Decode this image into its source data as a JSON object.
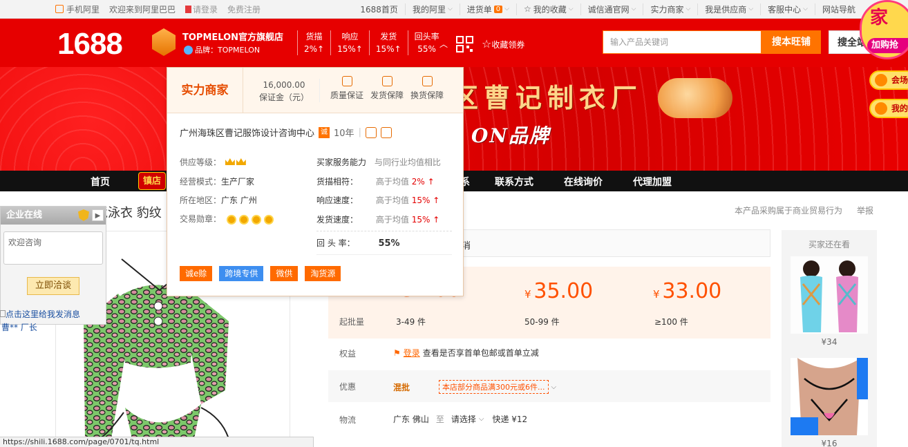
{
  "topnav": {
    "mobile": "手机阿里",
    "welcome": "欢迎来到阿里巴巴",
    "login": "请登录",
    "register": "免费注册",
    "links": [
      {
        "label": "1688首页"
      },
      {
        "label": "我的阿里"
      },
      {
        "label": "进货单",
        "badge": "0"
      },
      {
        "label": "我的收藏"
      },
      {
        "label": "诚信通官网"
      },
      {
        "label": "实力商家"
      },
      {
        "label": "我是供应商"
      },
      {
        "label": "客服中心"
      },
      {
        "label": "网站导航"
      }
    ]
  },
  "header": {
    "logo": "1688",
    "shop_name": "TOPMELON官方旗舰店",
    "brand_label": "品牌：TOPMELON",
    "metrics": [
      {
        "label": "货描",
        "value": "2%↑"
      },
      {
        "label": "响应",
        "value": "15%↑"
      },
      {
        "label": "发货",
        "value": "15%↑"
      },
      {
        "label": "回头率",
        "value": "55%"
      }
    ],
    "fav_coupon": "收藏领券",
    "search_placeholder": "输入产品关键词",
    "search_shop_btn": "搜本旺铺",
    "search_all_btn": "搜全站"
  },
  "promo_side": {
    "big_title": "家",
    "big_button": "加购抢",
    "pill1": "会场",
    "pill2": "我的"
  },
  "banner": {
    "title": "区曹记制衣厂",
    "subtitle": "ON品牌"
  },
  "shopnav": {
    "items": [
      "首页",
      "镇店",
      "联系方式",
      "在线询价",
      "代理加盟"
    ],
    "partial": "系"
  },
  "product": {
    "title": "跨境泳衣 豹纹",
    "report_text": "本产品采购属于商业贸易行为",
    "report_link": "举报"
  },
  "chat_widget": {
    "title": "企业在线",
    "message_placeholder": "欢迎咨询",
    "button": "立即洽谈",
    "link": "点击这里给我发消息",
    "contact": "曹** 厂长"
  },
  "popover": {
    "merchant_label": "实力商家",
    "deposit_amount": "16,000.00",
    "deposit_label": "保证金（元）",
    "guarantees": [
      "质量保证",
      "发货保障",
      "换货保障"
    ],
    "company": "广州海珠区曹记服饰设计咨询中心",
    "years": "10年",
    "year_badge": "诚",
    "supplier_level_label": "供应等级：",
    "business_model_label": "经营模式：",
    "business_model": "生产厂家",
    "region_label": "所在地区：",
    "region": "广东 广州",
    "trade_medal_label": "交易勋章：",
    "service_title": "买家服务能力",
    "service_compare": "与同行业均值相比",
    "service_rows": [
      {
        "label": "货描相符：",
        "text": "高于均值",
        "pct": "2%",
        "arrow": "↑"
      },
      {
        "label": "响应速度：",
        "text": "高于均值",
        "pct": "15%",
        "arrow": "↑"
      },
      {
        "label": "发货速度：",
        "text": "高于均值",
        "pct": "15%",
        "arrow": "↑"
      }
    ],
    "return_label": "回 头 率：",
    "return_value": "55%",
    "tags": [
      {
        "label": "诚e赊",
        "color": "#ff6a00"
      },
      {
        "label": "跨境专供",
        "color": "#3d8ef0"
      },
      {
        "label": "微供",
        "color": "#ff6a00"
      },
      {
        "label": "淘货源",
        "color": "#ff6a00"
      }
    ]
  },
  "pricing": {
    "promo_partial": "消",
    "label": "起批量",
    "tiers": [
      {
        "price": "37.00",
        "qty": "3-49 件"
      },
      {
        "price": "35.00",
        "qty": "50-99 件"
      },
      {
        "price": "33.00",
        "qty": "≥100 件"
      }
    ],
    "currency": "¥"
  },
  "rows": {
    "benefit_label": "权益",
    "benefit_login": "登录",
    "benefit_text": "查看是否享首单包邮或首单立减",
    "discount_label": "优惠",
    "discount_type": "混批",
    "discount_tag": "本店部分商品满300元或6件...",
    "logistics_label": "物流",
    "from": "广东 佛山",
    "to_label": "至",
    "select": "请选择",
    "express": "快递 ¥12"
  },
  "rail": {
    "title": "买家还在看",
    "items": [
      {
        "price": "¥34"
      },
      {
        "price": "¥16"
      }
    ]
  },
  "statusbar": "https://shili.1688.com/page/0701/tq.html"
}
